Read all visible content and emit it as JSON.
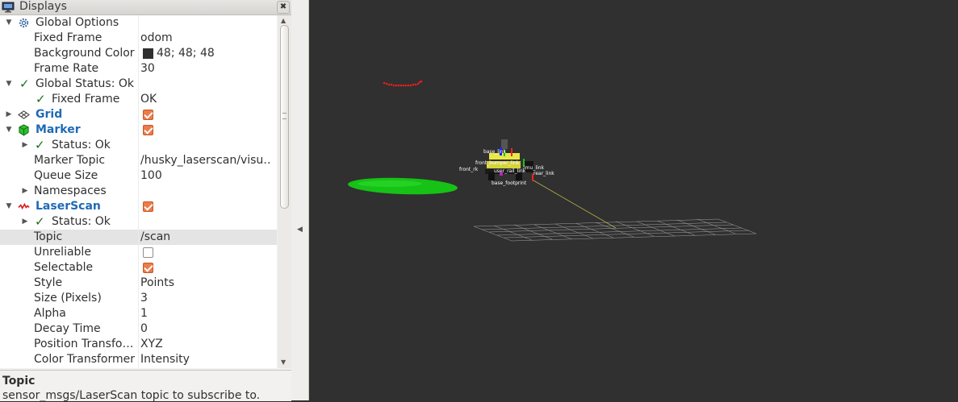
{
  "panel": {
    "title": "Displays",
    "close_symbol": "✖",
    "icon": "monitor-icon",
    "help_title": "Topic",
    "help_text": "sensor_msgs/LaserScan topic to subscribe to."
  },
  "tree": {
    "global_options": {
      "label": "Global Options",
      "fixed_frame_label": "Fixed Frame",
      "fixed_frame_value": "odom",
      "background_label": "Background Color",
      "background_value": "48; 48; 48",
      "background_color": "#303030",
      "frame_rate_label": "Frame Rate",
      "frame_rate_value": "30"
    },
    "global_status": {
      "label": "Global Status: Ok",
      "fixed_frame_label": "Fixed Frame",
      "fixed_frame_value": "OK"
    },
    "grid": {
      "label": "Grid",
      "enabled": true
    },
    "marker": {
      "label": "Marker",
      "enabled": true,
      "status_label": "Status: Ok",
      "topic_label": "Marker Topic",
      "topic_value": "/husky_laserscan/visu…",
      "queue_label": "Queue Size",
      "queue_value": "100",
      "namespaces_label": "Namespaces"
    },
    "laserscan": {
      "label": "LaserScan",
      "enabled": true,
      "status_label": "Status: Ok",
      "topic_label": "Topic",
      "topic_value": "/scan",
      "unreliable_label": "Unreliable",
      "unreliable": false,
      "selectable_label": "Selectable",
      "selectable": true,
      "style_label": "Style",
      "style_value": "Points",
      "size_label": "Size (Pixels)",
      "size_value": "3",
      "alpha_label": "Alpha",
      "alpha_value": "1",
      "decay_label": "Decay Time",
      "decay_value": "0",
      "position_label": "Position Transfo…",
      "position_value": "XYZ",
      "color_label": "Color Transformer",
      "color_value": "Intensity"
    }
  },
  "viewport": {
    "background": "#303030",
    "robot_frame_labels": [
      "base_link",
      "front_bumper_link",
      "front_rk",
      "base_footprint",
      "user_rail_link",
      "rear_link",
      "imu_link"
    ]
  },
  "colors": {
    "accent_blue": "#1f6ab5",
    "checkbox_orange": "#ee7a48",
    "ok_green": "#1b6e1b",
    "laser_red": "#e02020",
    "marker_green": "#16c216"
  }
}
